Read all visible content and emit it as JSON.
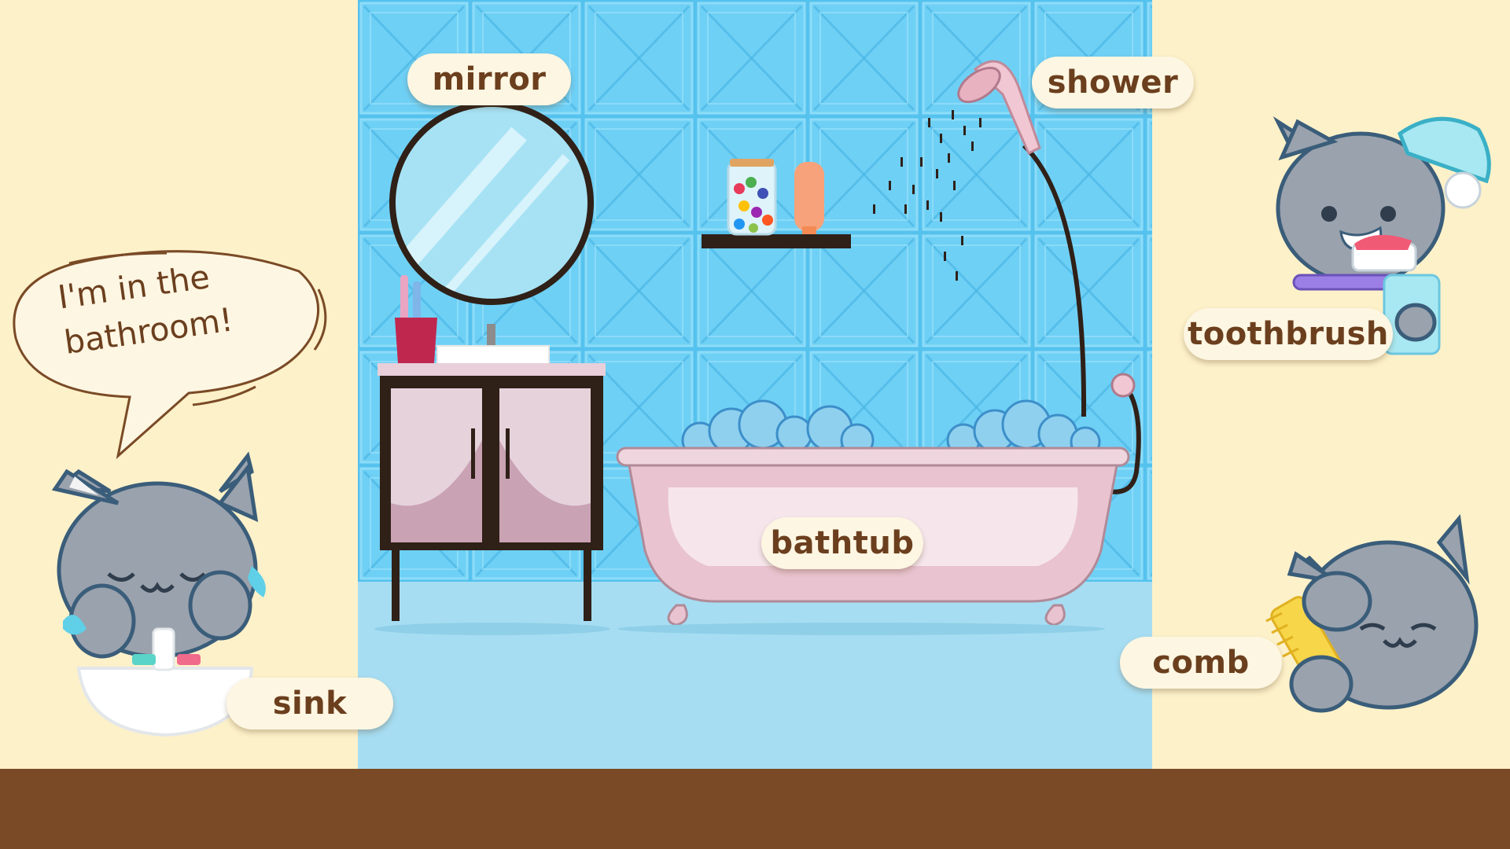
{
  "speech_bubble": {
    "line1": "I'm in the",
    "line2": "bathroom!"
  },
  "labels": {
    "mirror": "mirror",
    "shower": "shower",
    "toothbrush": "toothbrush",
    "bathtub": "bathtub",
    "sink": "sink",
    "comb": "comb"
  },
  "colors": {
    "background_cream": "#fdf1c9",
    "tile_blue": "#5cc7f0",
    "floor_blue": "#a6ddf2",
    "brown_floor": "#7a4a26",
    "label_text": "#6b3f1e",
    "cat_gray": "#9aa2ad"
  }
}
